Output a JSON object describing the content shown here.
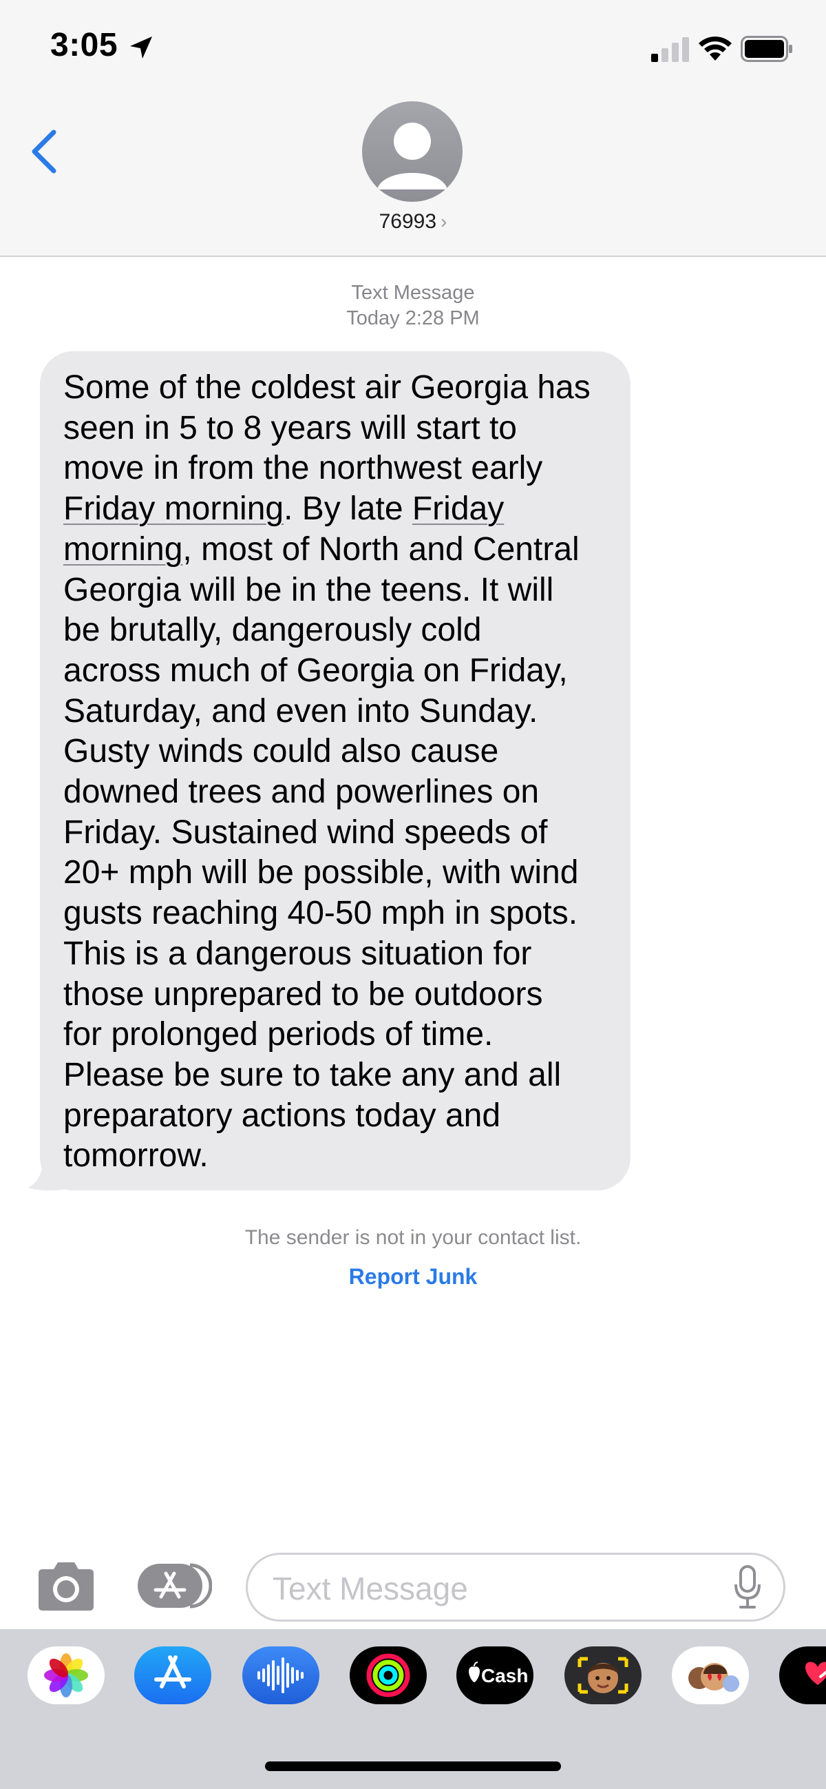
{
  "status_bar": {
    "time": "3:05",
    "icons": [
      "location-arrow-icon",
      "cellular-signal-icon",
      "wifi-icon",
      "battery-icon"
    ]
  },
  "header": {
    "contact_name": "76993",
    "icons": [
      "back-chevron-icon",
      "contact-avatar-icon",
      "chevron-right-icon"
    ]
  },
  "conversation": {
    "label": "Text Message",
    "timestamp": "Today 2:28 PM",
    "message": {
      "lines": [
        "Some of the coldest air Georgia has",
        "seen in 5 to 8 years will start to",
        "move in from the northwest early",
        "Friday morning",
        ". By late ",
        "Friday",
        "morning",
        ", most of North and Central",
        "Georgia will be in the teens. It will",
        "be brutally, dangerously cold",
        "across much of Georgia on Friday,",
        "Saturday, and even into Sunday.",
        "Gusty winds could also cause",
        "downed trees and powerlines on",
        "Friday. Sustained wind speeds of",
        "20+ mph will be possible, with wind",
        "gusts reaching 40-50 mph in spots.",
        "This is a dangerous situation for",
        "those unprepared to be outdoors",
        "for prolonged periods of time.",
        "Please be sure to take any and all",
        "preparatory actions today and",
        "tomorrow."
      ]
    },
    "notice": "The sender is not in your contact list.",
    "report_junk": "Report Junk"
  },
  "composer": {
    "placeholder": "Text Message",
    "icons": [
      "camera-icon",
      "app-store-apps-icon",
      "microphone-icon"
    ]
  },
  "app_tray": {
    "apps": [
      {
        "name": "photos-app-icon"
      },
      {
        "name": "app-store-app-icon"
      },
      {
        "name": "audio-message-app-icon"
      },
      {
        "name": "activity-app-icon"
      },
      {
        "name": "apple-cash-app-icon",
        "label": "Cash"
      },
      {
        "name": "memoji-app-icon"
      },
      {
        "name": "memoji-stickers-app-icon"
      },
      {
        "name": "digital-touch-app-icon"
      }
    ]
  },
  "colors": {
    "accent_blue": "#2a7be6",
    "bubble_gray": "#e9e9eb",
    "header_bg": "#f6f6f7",
    "tray_bg": "#d2d3d8"
  }
}
